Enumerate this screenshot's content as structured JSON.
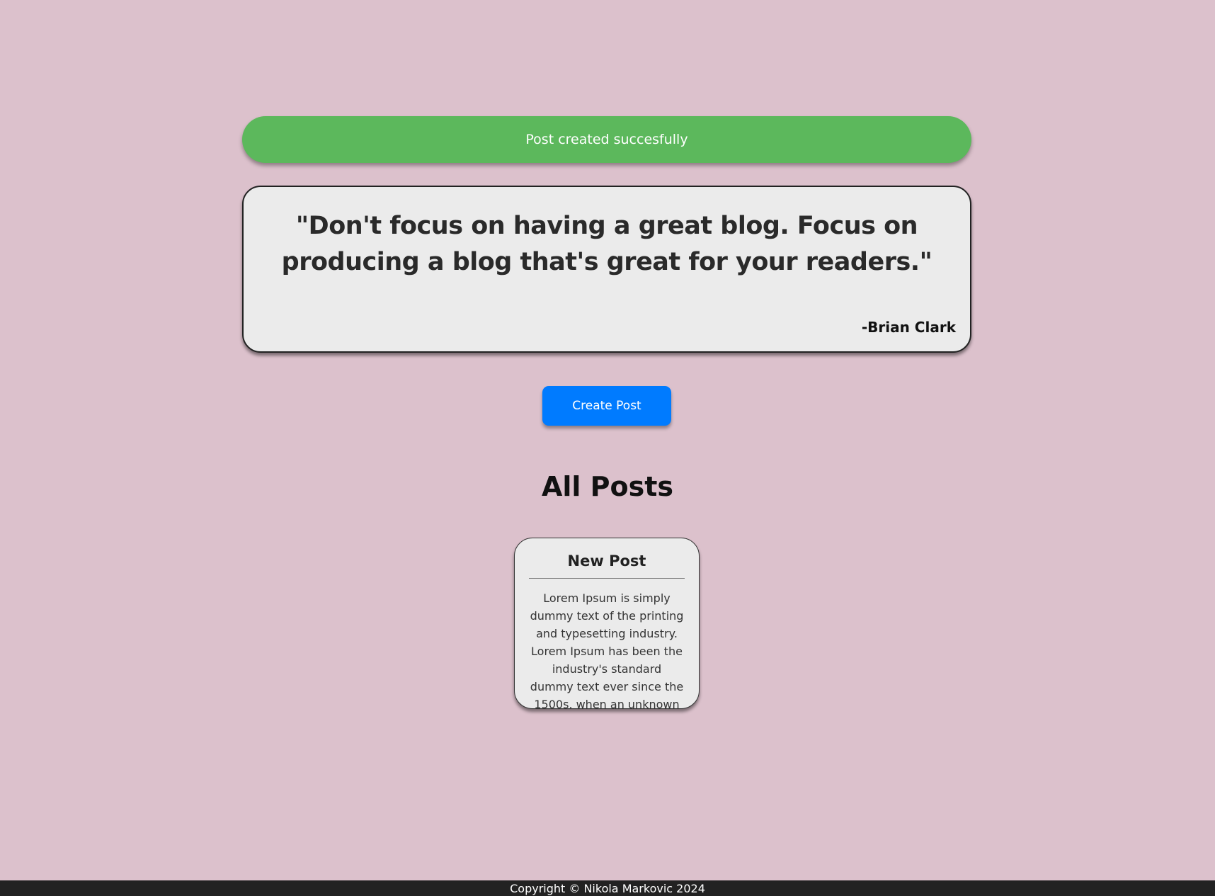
{
  "alert": {
    "message": "Post created succesfully",
    "color": "#5cb85c"
  },
  "quote": {
    "text": "\"Don't focus on having a great blog. Focus on producing a blog that's great for your readers.\"",
    "author": "-Brian Clark"
  },
  "actions": {
    "create_post_label": "Create Post",
    "button_color": "#007bff"
  },
  "posts_section": {
    "title": "All Posts",
    "posts": [
      {
        "title": "New Post",
        "body": "Lorem Ipsum is simply dummy text of the printing and typesetting industry. Lorem Ipsum has been the industry's standard dummy text ever since the 1500s, when an unknown"
      }
    ]
  },
  "footer": {
    "text": "Copyright © Nikola Markovic 2024"
  },
  "colors": {
    "background": "#dcc1cc",
    "card": "#ebebeb",
    "footer": "#222222"
  }
}
